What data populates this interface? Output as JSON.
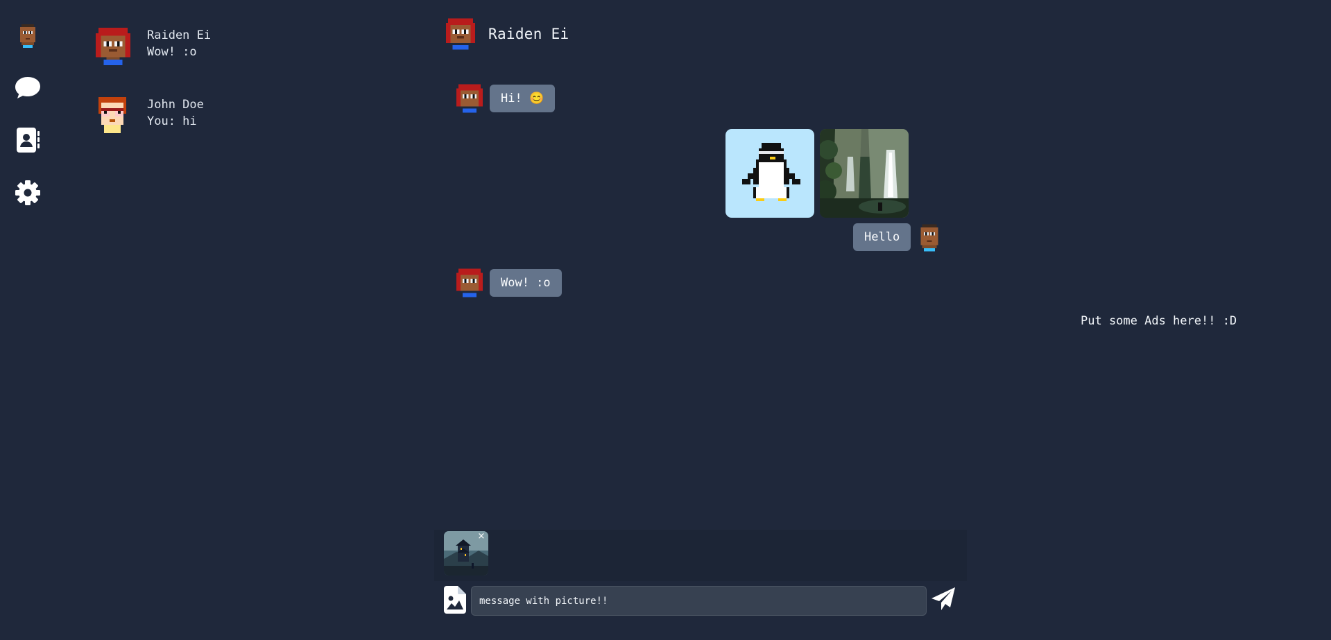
{
  "nav": {
    "items": [
      {
        "name": "profile-avatar"
      },
      {
        "name": "chat-bubble-icon"
      },
      {
        "name": "contacts-book-icon"
      },
      {
        "name": "gear-icon"
      }
    ]
  },
  "chats": [
    {
      "name": "Raiden Ei",
      "last": "Wow! :o"
    },
    {
      "name": "John Doe",
      "last": "You: hi"
    }
  ],
  "conversation": {
    "title": "Raiden Ei",
    "messages": [
      {
        "from": "Raiden Ei",
        "text": "Hi! 😊"
      },
      {
        "from": "me",
        "images": [
          "penguin-image",
          "waterfall-image"
        ]
      },
      {
        "from": "me",
        "text": "Hello"
      },
      {
        "from": "Raiden Ei",
        "text": "Wow! :o"
      }
    ]
  },
  "ads": {
    "text": "Put some Ads here!! :D"
  },
  "composer": {
    "attachment_remove": "×",
    "input_value": "message with picture!!",
    "file_icon": "file-image-icon",
    "send_icon": "paper-plane-icon"
  },
  "colors": {
    "background": "#1f283b",
    "bubble": "#64748b",
    "input": "#374151",
    "penguin_bg": "#bae6fd"
  }
}
